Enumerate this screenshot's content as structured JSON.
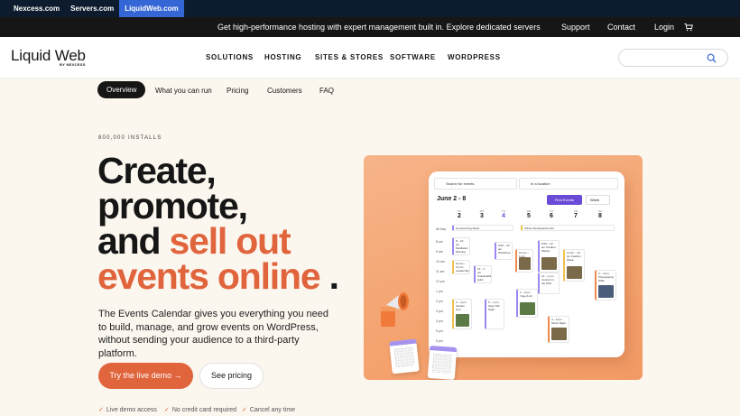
{
  "brand_bar": {
    "links": [
      "Nexcess.com",
      "Servers.com",
      "LiquidWeb.com"
    ],
    "active_index": 2,
    "active_color": "#3466d5",
    "background": "#0d1b2e"
  },
  "promo_bar": {
    "message": "Get high-performance hosting with expert management built in. Explore dedicated servers",
    "support": "Support",
    "contact": "Contact",
    "login": "Login",
    "cart_icon": "cart-icon"
  },
  "header": {
    "logo_text": "Liquid Web",
    "logo_byline": "BY NEXCESS",
    "nav": [
      "SOLUTIONS",
      "HOSTING",
      "SITES & STORES",
      "SOFTWARE",
      "WORDPRESS"
    ],
    "search_icon": "search-icon"
  },
  "subnav": {
    "items": [
      "Overview",
      "What you can run",
      "Pricing",
      "Customers",
      "FAQ"
    ],
    "active_index": 0
  },
  "hero": {
    "eyebrow": "800,000 INSTALLS",
    "headline_line1": "Create,",
    "headline_line2": "promote,",
    "headline_line3_plain": "and ",
    "headline_line3_accent": "sell out",
    "headline_line4_accent": "events online",
    "headline_line4_end": " .",
    "lede": "The Events Calendar gives you everything you need to build, manage, and grow events on WordPress, without sending your audience to a third-party platform.",
    "cta_primary": "Try the live demo",
    "cta_primary_arrow": "→",
    "cta_secondary": "See pricing",
    "perks": [
      "Live demo access",
      "No credit card required",
      "Cancel any time"
    ],
    "accent_color": "#e0643c"
  },
  "calendar_mockup": {
    "search_placeholder": "Search for events",
    "location_placeholder": "In a location",
    "range": "June 2 - 8",
    "find_button": "Find Events",
    "view_select": "Week",
    "days": [
      {
        "dow": "SU",
        "num": "2"
      },
      {
        "dow": "MO",
        "num": "3"
      },
      {
        "dow": "TU",
        "num": "4"
      },
      {
        "dow": "WE",
        "num": "5"
      },
      {
        "dow": "TH",
        "num": "6"
      },
      {
        "dow": "FR",
        "num": "7"
      },
      {
        "dow": "SA",
        "num": "8"
      }
    ],
    "today_index": 2,
    "hours": [
      "All Day",
      "8 am",
      "9 am",
      "10 am",
      "11 am",
      "12 pm",
      "1 pm",
      "2 pm",
      "3 pm",
      "4 pm",
      "5 pm",
      "6 pm"
    ],
    "events": [
      "Homecoming Week",
      "Winter Renaissance Fair",
      "8 – 10 am Meditation Morning",
      "9:00 – 10 am Workshop",
      "10 am – 1 pm",
      "9:00 – 10 am Outdoor Market",
      "11 am – 12 pm Fashion Week",
      "10 am – 12 pm Leadership Talk",
      "12 – 1 pm Sustainability Q&A",
      "12 – 1 pm Concert in the Park",
      "2 – 4 pm Photography Walk",
      "1 – 3 pm Yoga & Art",
      "3 – 4 pm Garden Tour",
      "5 – 7 pm Open Mic Night",
      "4 – 6 pm Movie Night"
    ]
  }
}
